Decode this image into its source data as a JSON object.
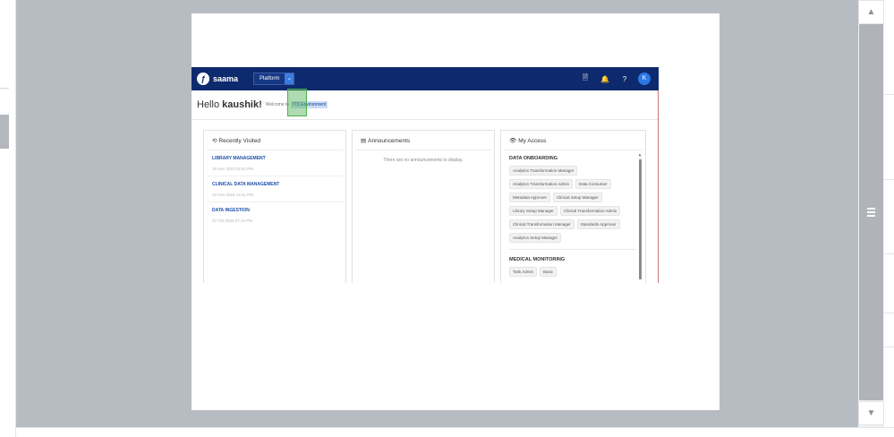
{
  "scroll": {
    "up_glyph": "▲",
    "down_glyph": "▼"
  },
  "app": {
    "logo_text": "saama",
    "logo_glyph": "ƒ",
    "platform_label": "Platform",
    "platform_caret": "⌄",
    "icons": {
      "doc": "🗎",
      "bell": "🔔",
      "help": "?"
    },
    "avatar_letter": "K",
    "greeting_prefix": "Hello ",
    "user_name": "kaushik!",
    "welcome_text": "Welcome to",
    "org_name": "ITS Environment"
  },
  "recent": {
    "title": "Recently Visited",
    "icon": "⟲",
    "items": [
      {
        "name": "LIBRARY MANAGEMENT",
        "time": "16 Nov 2023 04:51 PM"
      },
      {
        "name": "CLINICAL DATA MANAGEMENT",
        "time": "10 Nov 2023 12:41 PM"
      },
      {
        "name": "DATA INGESTION",
        "time": "27 Oct 2023 07:14 PM"
      }
    ]
  },
  "announcements": {
    "title": "Announcements",
    "icon": "▤",
    "empty_text": "There are no announcements to display."
  },
  "access": {
    "title": "My Access",
    "icon": "👁",
    "groups": [
      {
        "title": "DATA ONBOARDING",
        "roles": [
          "Analytics Transformation Manager",
          "Analytics Transformation Admin",
          "Data Consumer",
          "Metadata Approver",
          "Clinical Setup Manager",
          "Library Setup Manager",
          "Clinical Transformation Admin",
          "Clinical Transformation Manager",
          "Standards Approver",
          "Analytics Setup Manager"
        ]
      },
      {
        "title": "MEDICAL MONITORING",
        "roles": [
          "Task Admin",
          "Basic"
        ]
      }
    ]
  }
}
